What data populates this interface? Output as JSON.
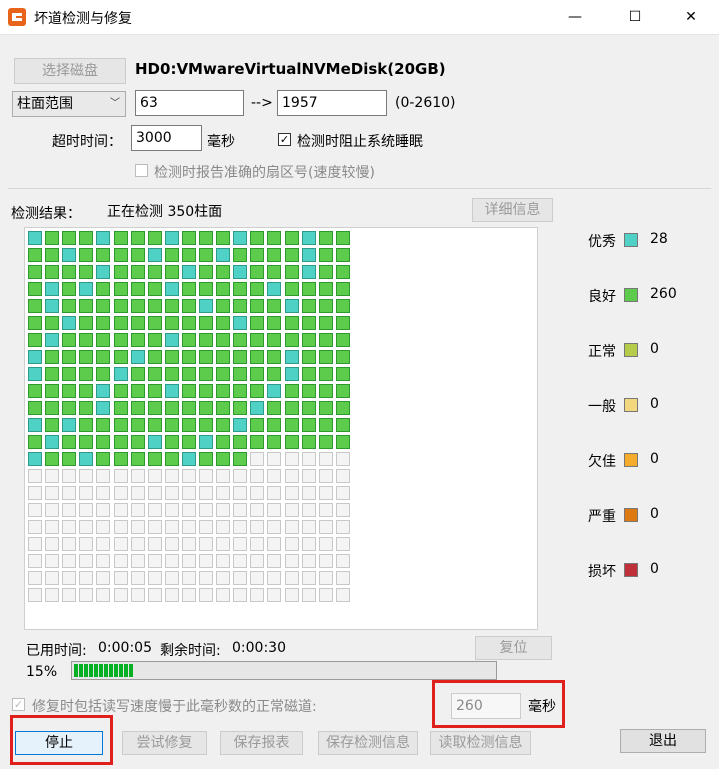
{
  "window": {
    "title": "坏道检测与修复",
    "minimize": "—",
    "maximize": "☐",
    "close": "✕"
  },
  "disk": {
    "select_button": "选择磁盘",
    "name": "HD0:VMwareVirtualNVMeDisk(20GB)"
  },
  "range": {
    "mode": "柱面范围",
    "start": "63",
    "arrow": "-->",
    "end": "1957",
    "hint": "(0-2610)"
  },
  "timeout": {
    "label": "超时时间：",
    "value": "3000",
    "unit": "毫秒"
  },
  "options": {
    "prevent_sleep_label": "检测时阻止系统睡眠",
    "prevent_sleep_checked": true,
    "report_sector_label": "检测时报告准确的扇区号(速度较慢)",
    "report_sector_checked": false
  },
  "result": {
    "label": "检测结果：",
    "status": "正在检测 350柱面",
    "details_button": "详细信息"
  },
  "grid": {
    "cols": 19,
    "rows": 22,
    "scanned": 260,
    "excellent_cells": [
      0,
      4,
      8,
      12,
      16,
      21,
      26,
      30,
      35,
      42,
      47,
      50,
      54,
      58,
      60,
      65,
      71,
      77,
      86,
      91,
      97,
      107,
      115,
      122,
      133,
      139,
      148,
      152,
      157,
      167,
      175,
      179,
      185,
      194,
      203,
      209,
      211,
      221,
      229,
      235,
      238,
      247,
      250,
      256
    ],
    "colors": {
      "excellent": "#4fd1c5",
      "good": "#5dcc4d",
      "good_border": "#2e9a2e",
      "excellent_border": "#2e9a8a",
      "pending": "#f4f4f4",
      "pending_border": "#c8c8c8"
    }
  },
  "legend": [
    {
      "label": "优秀",
      "color": "#4fd1c5",
      "count": "28"
    },
    {
      "label": "良好",
      "color": "#5dcc4d",
      "count": "260"
    },
    {
      "label": "正常",
      "color": "#b5cc4a",
      "count": "0"
    },
    {
      "label": "一般",
      "color": "#f2d77e",
      "count": "0"
    },
    {
      "label": "欠佳",
      "color": "#f5ab2c",
      "count": "0"
    },
    {
      "label": "严重",
      "color": "#de7a12",
      "count": "0"
    },
    {
      "label": "损坏",
      "color": "#c0303a",
      "count": "0"
    }
  ],
  "timing": {
    "elapsed_label": "已用时间:",
    "elapsed": "0:00:05",
    "remaining_label": "剩余时间:",
    "remaining": "0:00:30",
    "reset_button": "复位"
  },
  "progress": {
    "percent_text": "15%",
    "fraction": 0.15
  },
  "repair_option": {
    "label": "修复时包括读写速度慢于此毫秒数的正常磁道:",
    "checked": true,
    "value": "260",
    "unit": "毫秒"
  },
  "buttons": {
    "stop": "停止",
    "try_repair": "尝试修复",
    "save_report": "保存报表",
    "save_info": "保存检测信息",
    "read_info": "读取检测信息",
    "exit": "退出"
  }
}
